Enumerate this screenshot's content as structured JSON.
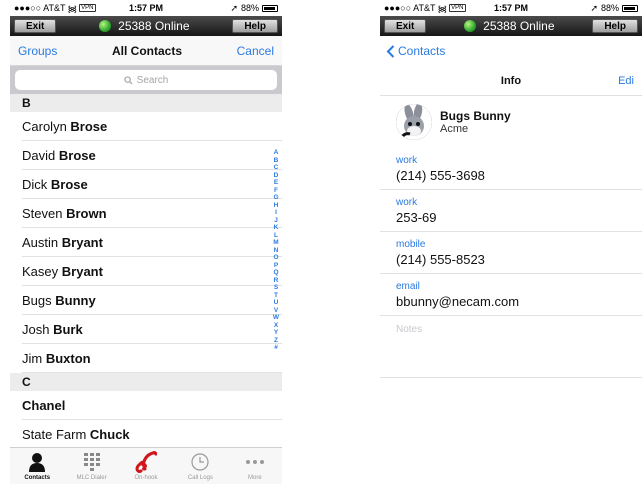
{
  "status": {
    "carrier": "●●●○○ AT&T",
    "vpn": "VPN",
    "time": "1:57 PM",
    "battery": "88%"
  },
  "topbar": {
    "exit": "Exit",
    "online": "25388 Online",
    "help": "Help"
  },
  "contacts": {
    "nav": {
      "left": "Groups",
      "title": "All Contacts",
      "right": "Cancel"
    },
    "search_placeholder": "Search",
    "sections": [
      {
        "header": "B",
        "rows": [
          {
            "first": "Carolyn",
            "last": "Brose"
          },
          {
            "first": "David",
            "last": "Brose"
          },
          {
            "first": "Dick",
            "last": "Brose"
          },
          {
            "first": "Steven",
            "last": "Brown"
          },
          {
            "first": "Austin",
            "last": "Bryant"
          },
          {
            "first": "Kasey",
            "last": "Bryant"
          },
          {
            "first": "Bugs",
            "last": "Bunny"
          },
          {
            "first": "Josh",
            "last": "Burk"
          },
          {
            "first": "Jim",
            "last": "Buxton"
          }
        ]
      },
      {
        "header": "C",
        "rows": [
          {
            "first": "",
            "last": "Chanel"
          },
          {
            "first": "State Farm",
            "last": "Chuck"
          }
        ]
      }
    ],
    "index": [
      "A",
      "B",
      "C",
      "D",
      "E",
      "F",
      "G",
      "H",
      "I",
      "J",
      "K",
      "L",
      "M",
      "N",
      "O",
      "P",
      "Q",
      "R",
      "S",
      "T",
      "U",
      "V",
      "W",
      "X",
      "Y",
      "Z",
      "#"
    ]
  },
  "tabs": [
    {
      "label": "Contacts",
      "icon": "person-icon"
    },
    {
      "label": "MLC Dialer",
      "icon": "keypad-icon"
    },
    {
      "label": "On-hook",
      "icon": "phone-handset-icon"
    },
    {
      "label": "Call Logs",
      "icon": "clock-icon"
    },
    {
      "label": "More",
      "icon": "ellipsis-icon"
    }
  ],
  "info": {
    "nav": {
      "back": "Contacts",
      "title": "Info",
      "edit": "Edi"
    },
    "name": "Bugs Bunny",
    "company": "Acme",
    "fields": [
      {
        "label": "work",
        "value": "(214) 555-3698"
      },
      {
        "label": "work",
        "value": "253-69"
      },
      {
        "label": "mobile",
        "value": "(214) 555-8523"
      },
      {
        "label": "email",
        "value": "bbunny@necam.com"
      }
    ],
    "notes_placeholder": "Notes"
  },
  "colors": {
    "accent": "#2a7ae2",
    "online": "#2fa82f",
    "onhook": "#d0161c"
  }
}
